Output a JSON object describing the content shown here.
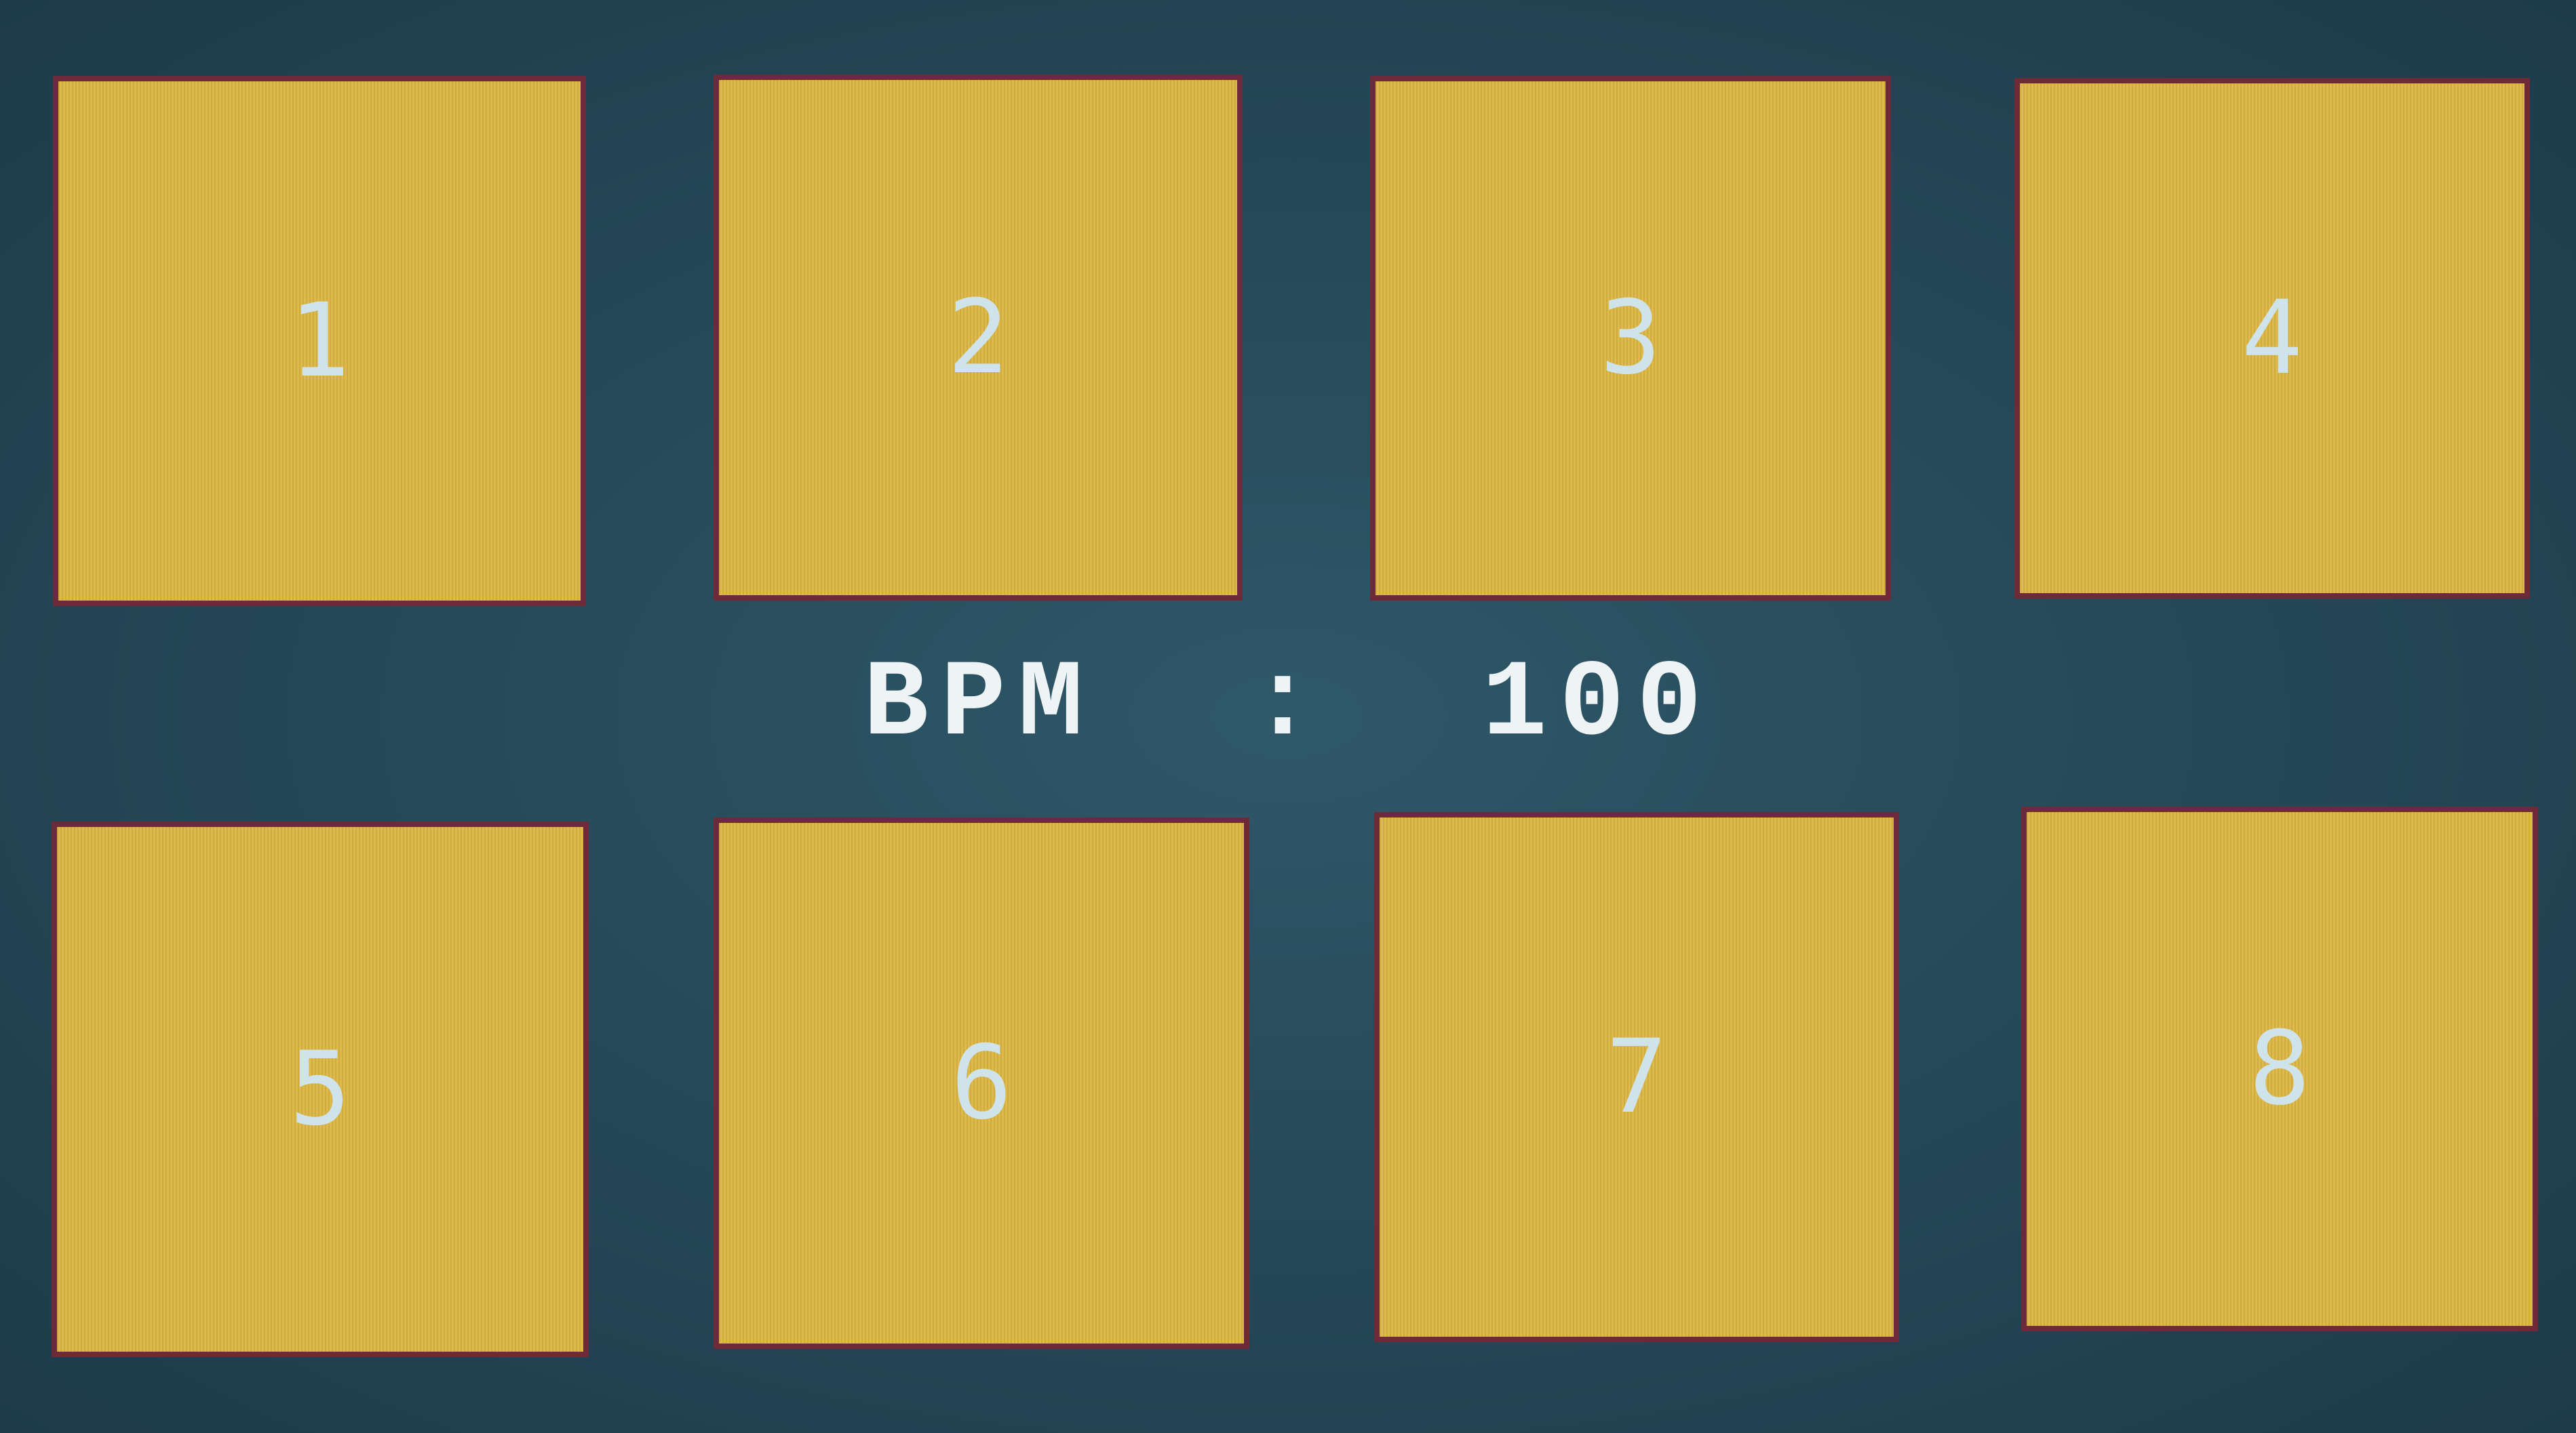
{
  "pads": [
    {
      "label": "1"
    },
    {
      "label": "2"
    },
    {
      "label": "3"
    },
    {
      "label": "4"
    },
    {
      "label": "5"
    },
    {
      "label": "6"
    },
    {
      "label": "7"
    },
    {
      "label": "8"
    }
  ],
  "bpm": {
    "label": "BPM",
    "separator": ":",
    "value": "100"
  },
  "colors": {
    "background": "#264a5a",
    "pad_fill": "#ddb644",
    "pad_border": "#6e2a38",
    "pad_label": "#cfe3ea",
    "bpm_text": "#eef3f5"
  }
}
